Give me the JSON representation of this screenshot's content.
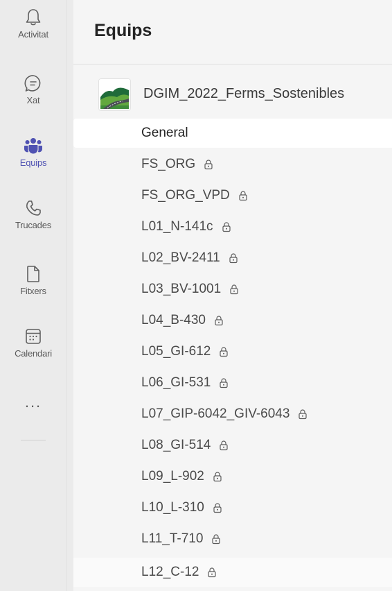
{
  "rail": {
    "items": [
      {
        "label": "Activitat",
        "icon": "bell-icon"
      },
      {
        "label": "Xat",
        "icon": "chat-icon"
      },
      {
        "label": "Equips",
        "icon": "teams-icon",
        "active": true
      },
      {
        "label": "Trucades",
        "icon": "phone-icon"
      },
      {
        "label": "Fitxers",
        "icon": "file-icon"
      },
      {
        "label": "Calendari",
        "icon": "calendar-icon"
      }
    ],
    "more": "..."
  },
  "panel": {
    "title": "Equips",
    "team": {
      "name": "DGIM_2022_Ferms_Sostenibles",
      "logo": "road-landscape-logo"
    },
    "channels": [
      {
        "name": "General",
        "private": false,
        "selected": true
      },
      {
        "name": "FS_ORG",
        "private": true
      },
      {
        "name": "FS_ORG_VPD",
        "private": true
      },
      {
        "name": "L01_N-141c",
        "private": true
      },
      {
        "name": "L02_BV-2411",
        "private": true
      },
      {
        "name": "L03_BV-1001",
        "private": true
      },
      {
        "name": "L04_B-430",
        "private": true
      },
      {
        "name": "L05_GI-612",
        "private": true
      },
      {
        "name": "L06_GI-531",
        "private": true
      },
      {
        "name": "L07_GIP-6042_GIV-6043",
        "private": true
      },
      {
        "name": "L08_GI-514",
        "private": true
      },
      {
        "name": "L09_L-902",
        "private": true
      },
      {
        "name": "L10_L-310",
        "private": true
      },
      {
        "name": "L11_T-710",
        "private": true
      },
      {
        "name": "L12_C-12",
        "private": true
      }
    ]
  },
  "colors": {
    "accent": "#4f52b2",
    "rail_bg": "#ebebeb",
    "panel_bg": "#f5f5f5",
    "selected_bg": "#ffffff"
  }
}
